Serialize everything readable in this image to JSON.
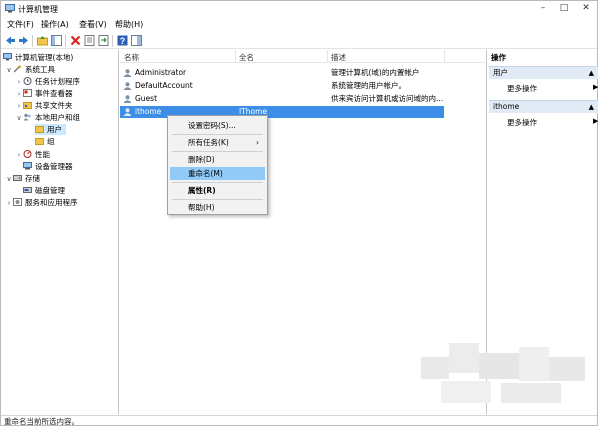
{
  "window": {
    "title": "计算机管理"
  },
  "menubar": {
    "items": [
      "文件(F)",
      "操作(A)",
      "查看(V)",
      "帮助(H)"
    ]
  },
  "tree": {
    "items": [
      {
        "label": "计算机管理(本地)",
        "icon": "computer-icon"
      },
      {
        "label": "系统工具",
        "icon": "tools-icon"
      },
      {
        "label": "任务计划程序",
        "icon": "clock-icon"
      },
      {
        "label": "事件查看器",
        "icon": "event-icon"
      },
      {
        "label": "共享文件夹",
        "icon": "shared-folder-icon"
      },
      {
        "label": "本地用户和组",
        "icon": "users-icon"
      },
      {
        "label": "用户",
        "icon": "folder-icon"
      },
      {
        "label": "组",
        "icon": "folder-icon"
      },
      {
        "label": "性能",
        "icon": "performance-icon"
      },
      {
        "label": "设备管理器",
        "icon": "device-icon"
      },
      {
        "label": "存储",
        "icon": "storage-icon"
      },
      {
        "label": "磁盘管理",
        "icon": "disk-icon"
      },
      {
        "label": "服务和应用程序",
        "icon": "services-icon"
      }
    ]
  },
  "list": {
    "columns": [
      "名称",
      "全名",
      "描述"
    ],
    "rows": [
      {
        "name": "Administrator",
        "fullname": "",
        "description": "管理计算机(域)的内置帐户"
      },
      {
        "name": "DefaultAccount",
        "fullname": "",
        "description": "系统管理的用户帐户。"
      },
      {
        "name": "Guest",
        "fullname": "",
        "description": "供来宾访问计算机或访问域的内..."
      },
      {
        "name": "ithome",
        "fullname": "IThome",
        "description": ""
      }
    ]
  },
  "context_menu": {
    "items": [
      "设置密码(S)...",
      "所有任务(K)",
      "删除(D)",
      "重命名(M)",
      "属性(R)",
      "帮助(H)"
    ],
    "submenu_arrow": "›"
  },
  "actions": {
    "title": "操作",
    "sections": [
      {
        "header": "用户",
        "link": "更多操作"
      },
      {
        "header": "ithome",
        "link": "更多操作"
      }
    ]
  },
  "status": {
    "text": "重命名当前所选内容。"
  },
  "colors": {
    "selection": "#3d8ee6",
    "menu_highlight": "#91c9f7",
    "action_band": "#e1ebf5"
  }
}
